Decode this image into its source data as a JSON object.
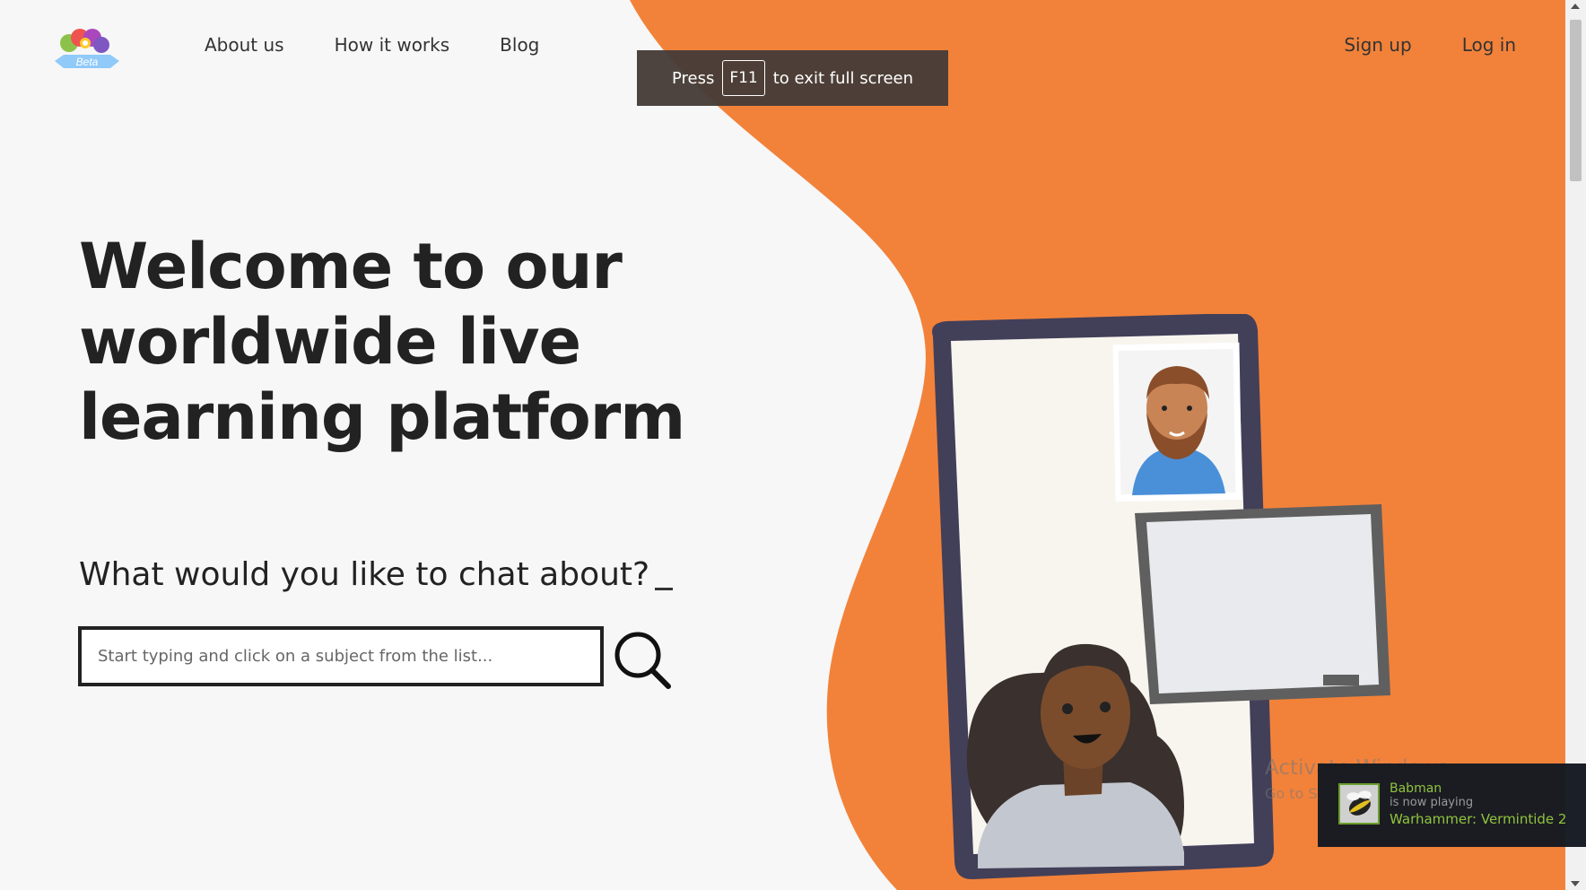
{
  "colors": {
    "accent": "#f2823a",
    "text": "#222222",
    "background": "#f7f7f7"
  },
  "logo": {
    "badge_text": "Beta"
  },
  "nav": {
    "left": [
      {
        "label": "About us"
      },
      {
        "label": "How it works"
      },
      {
        "label": "Blog"
      }
    ],
    "right": [
      {
        "label": "Sign up"
      },
      {
        "label": "Log in"
      }
    ]
  },
  "fullscreen_notice": {
    "prefix": "Press",
    "key": "F11",
    "suffix": "to exit full screen"
  },
  "hero": {
    "title": "Welcome to our worldwide live learning platform",
    "question": "What would you like to chat about?",
    "search_placeholder": "Start typing and click on a subject from the list...",
    "search_icon": "search-icon"
  },
  "windows_watermark": {
    "title": "Activate Windows",
    "subtitle": "Go to Settings to activate Windows."
  },
  "steam_notification": {
    "name": "Babman",
    "status": "is now playing",
    "game": "Warhammer: Vermintide 2"
  }
}
